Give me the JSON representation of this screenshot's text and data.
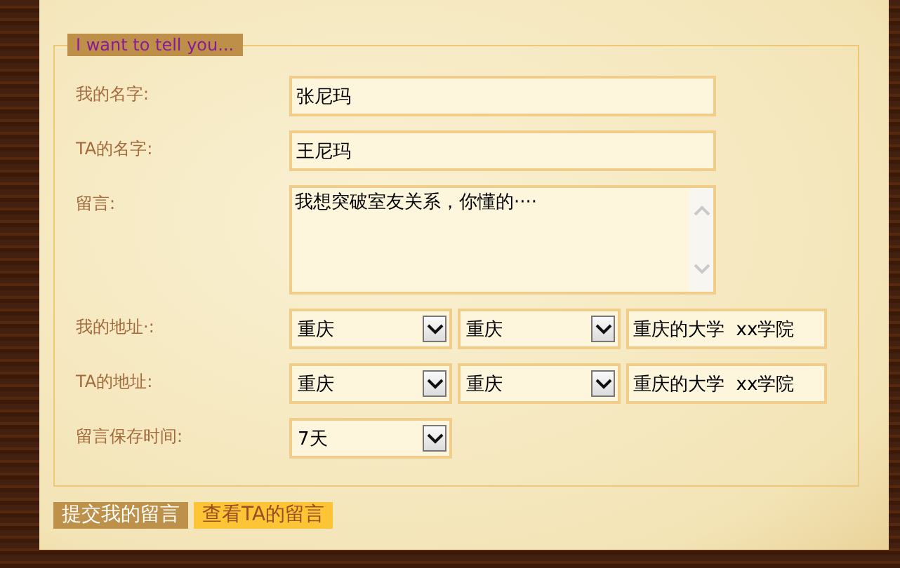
{
  "legend": "I want to tell you...",
  "rows": [
    {
      "label": "我的名字:",
      "controls": [
        {
          "kind": "text",
          "value": "张尼玛"
        }
      ]
    },
    {
      "label": "TA的名字:",
      "controls": [
        {
          "kind": "text",
          "value": "王尼玛"
        }
      ]
    },
    {
      "label": "留言:",
      "controls": [
        {
          "kind": "textarea",
          "value": "我想突破室友关系，你懂的····"
        }
      ]
    },
    {
      "label": "我的地址·:",
      "controls": [
        {
          "kind": "select",
          "value": "重庆"
        },
        {
          "kind": "select",
          "value": "重庆"
        },
        {
          "kind": "short",
          "value": "重庆的大学  xx学院"
        }
      ]
    },
    {
      "label": "TA的地址:",
      "controls": [
        {
          "kind": "select",
          "value": "重庆"
        },
        {
          "kind": "select",
          "value": "重庆"
        },
        {
          "kind": "short",
          "value": "重庆的大学  xx学院"
        }
      ]
    },
    {
      "label": "留言保存时间:",
      "controls": [
        {
          "kind": "select",
          "value": "7天"
        }
      ]
    }
  ],
  "buttons": [
    {
      "label": "提交我的留言",
      "kind": "primary"
    },
    {
      "label": "查看TA的留言",
      "kind": "secondary"
    }
  ]
}
